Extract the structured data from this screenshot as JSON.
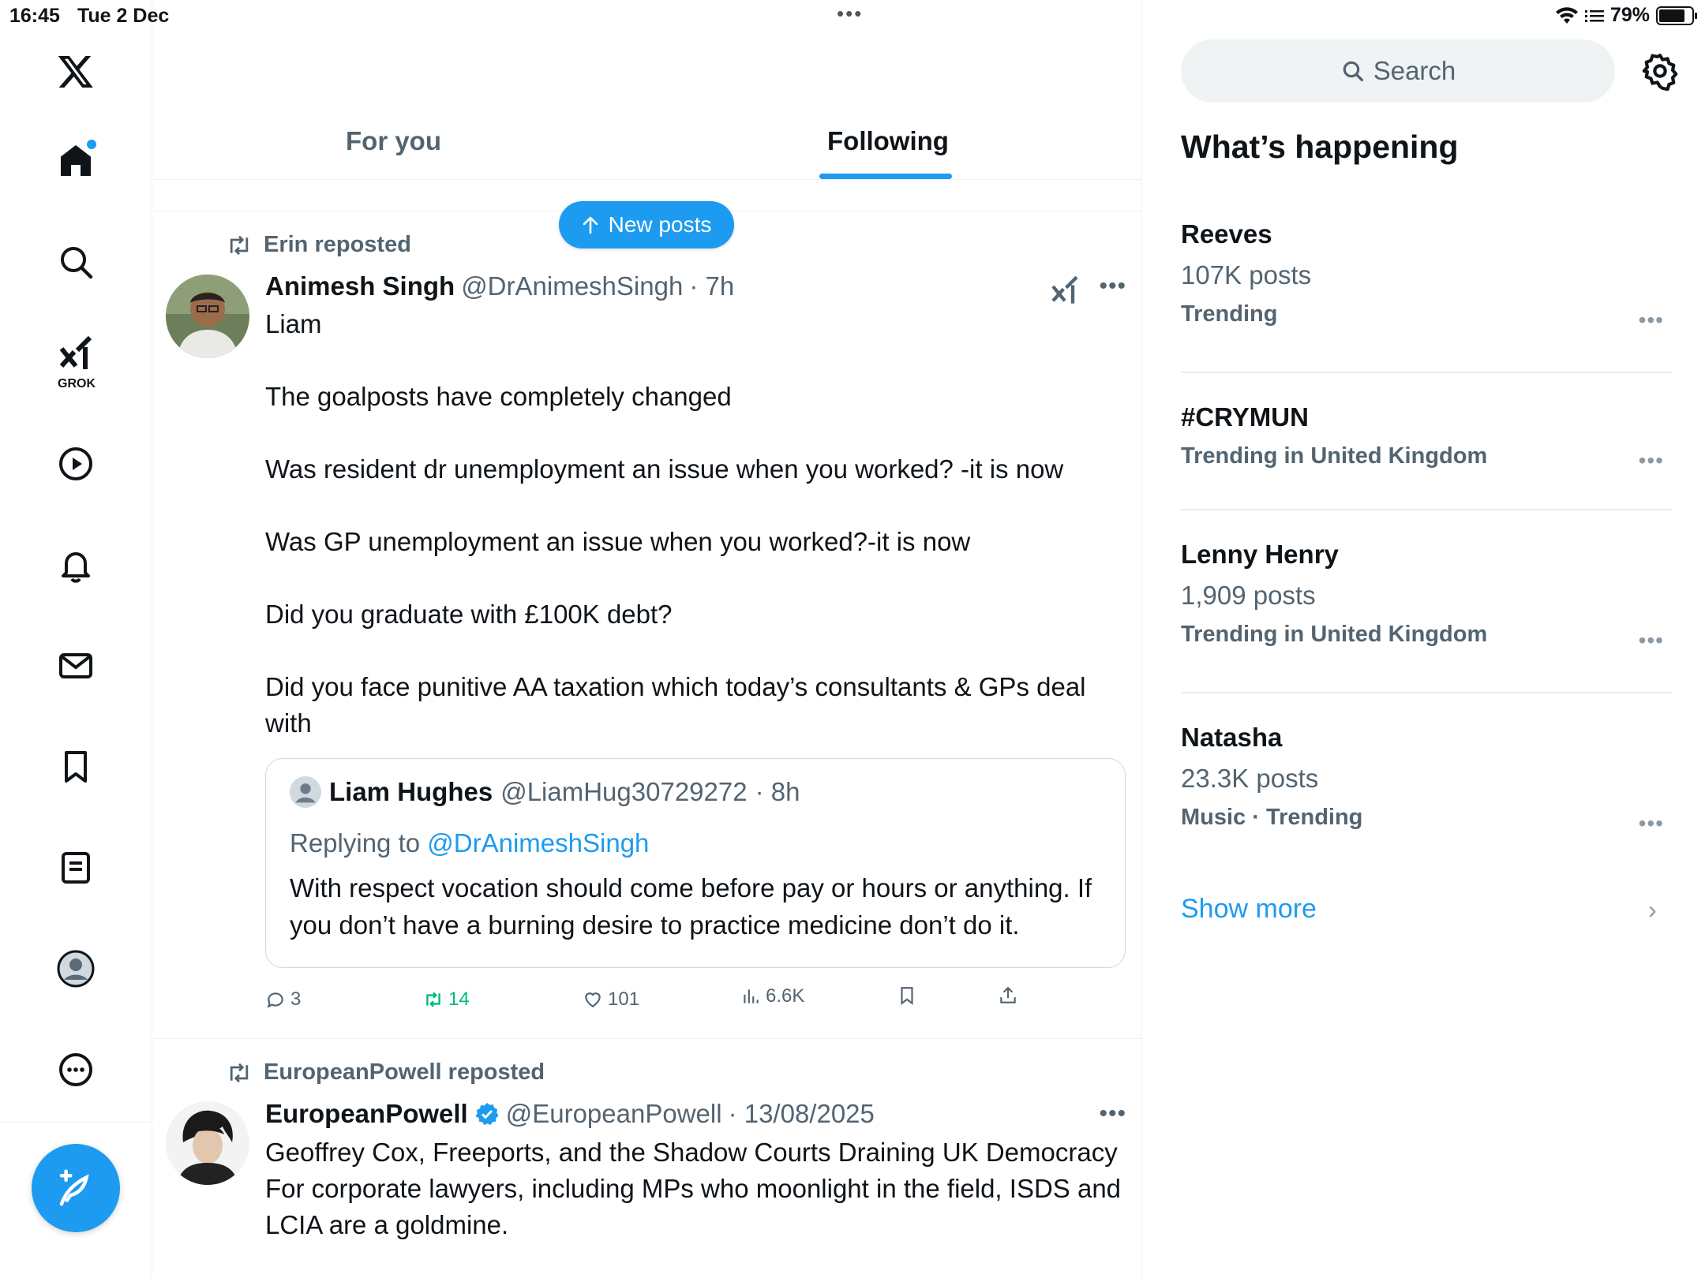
{
  "status_bar": {
    "time": "16:45",
    "date": "Tue 2 Dec",
    "battery": "79%",
    "battery_level": 0.79
  },
  "nav": {
    "grok_label": "GROK"
  },
  "header": {
    "tabs": [
      {
        "label": "For you"
      },
      {
        "label": "Following"
      }
    ],
    "active_tab": "Following"
  },
  "new_posts_button": {
    "label": "New posts"
  },
  "posts": [
    {
      "repost_by": "Erin reposted",
      "name": "Animesh Singh",
      "handle": "@DrAnimeshSingh",
      "time": "· 7h",
      "paragraphs": [
        "Liam",
        "The goalposts have completely changed",
        "Was resident dr unemployment an issue when you worked? -it is now",
        "Was GP unemployment an issue when you worked?-it is now",
        "Did you graduate with £100K debt?",
        "Did you face punitive AA taxation which today’s consultants & GPs deal with"
      ],
      "quote": {
        "name": "Liam Hughes",
        "handle": "@LiamHug30729272",
        "time": "· 8h",
        "replying_prefix": "Replying to",
        "replying_to": "@DrAnimeshSingh",
        "text": "With respect vocation should come before pay or hours or anything. If you don’t have a burning desire to practice medicine don’t do it."
      },
      "stats": {
        "replies": "3",
        "reposts": "14",
        "likes": "101",
        "views": "6.6K"
      }
    },
    {
      "repost_by": "EuropeanPowell reposted",
      "name": "EuropeanPowell",
      "handle": "@EuropeanPowell",
      "time": "· 13/08/2025",
      "text_lines": [
        "Geoffrey Cox, Freeports, and the Shadow Courts Draining UK Democracy",
        "For corporate lawyers, including MPs who moonlight in the field, ISDS and LCIA are a goldmine."
      ]
    }
  ],
  "sidebar": {
    "search_placeholder": "Search",
    "whats_happening": "What’s happening",
    "trends": [
      {
        "title": "Reeves",
        "posts": "107K posts",
        "meta": "Trending"
      },
      {
        "title": "#CRYMUN",
        "posts": "",
        "meta": "Trending in United Kingdom"
      },
      {
        "title": "Lenny Henry",
        "posts": "1,909 posts",
        "meta": "Trending in United Kingdom"
      },
      {
        "title": "Natasha",
        "posts": "23.3K posts",
        "meta": "Music · Trending"
      }
    ],
    "show_more": "Show more"
  },
  "colors": {
    "accent": "#1d9bf0",
    "repost_green": "#00ba7c",
    "muted": "#536471"
  }
}
